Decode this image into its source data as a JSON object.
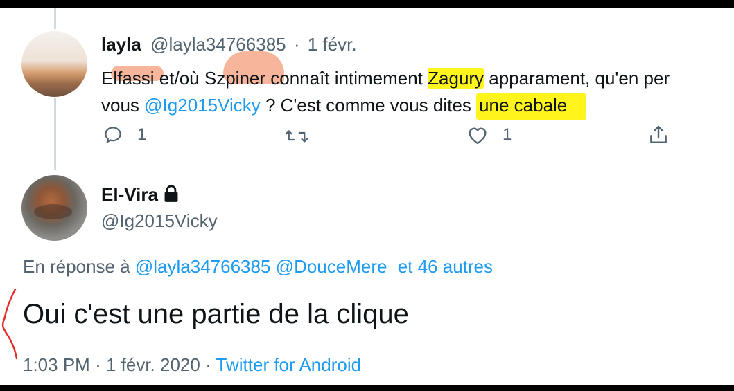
{
  "tweet1": {
    "name": "layla",
    "handle": "@layla34766385",
    "separator": "·",
    "date": "1 févr.",
    "text_line1_part1": "Elfassi",
    "text_line1_part2": " et/où ",
    "text_line1_part3": "Szpiner",
    "text_line1_part4": " connaît intimement ",
    "text_line1_part5": "Zagury",
    "text_line1_part6": " apparament, qu'en per",
    "text_line2_part1": "vous ",
    "text_line2_mention": "@Ig2015Vicky",
    "text_line2_part2": " ? C'est comme vous dites ",
    "text_line2_highlight": "une cabale",
    "reply_count": "1",
    "like_count": "1",
    "icons": [
      "reply-icon",
      "retweet-icon",
      "like-icon",
      "share-icon"
    ]
  },
  "tweet2": {
    "name": "El-Vira",
    "handle": "@Ig2015Vicky",
    "reply_prefix": "En réponse à ",
    "reply_mention1": "@layla34766385",
    "reply_mention2": "@DouceMere",
    "reply_others": "et 46 autres",
    "text": "Oui c'est une partie de la clique",
    "time": "1:03 PM",
    "meta_sep": "·",
    "date": "1 févr. 2020",
    "source": "Twitter for Android",
    "icons": [
      "lock-icon"
    ]
  },
  "colors": {
    "link": "#1d9bf0",
    "secondary": "#536471",
    "highlight_yellow": "#fff41c",
    "highlight_salmon": "#f6a98a",
    "annotation_red": "#e0302a"
  }
}
